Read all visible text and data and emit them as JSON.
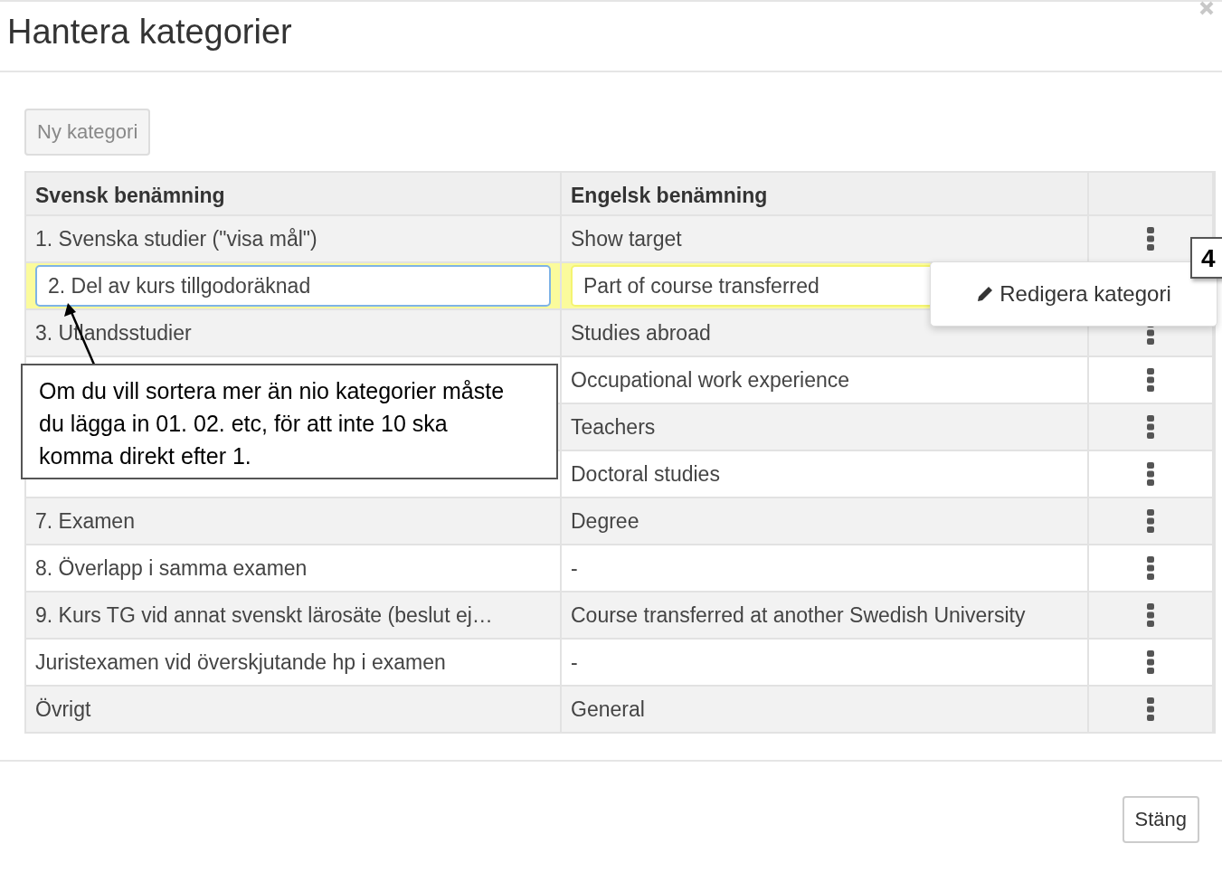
{
  "dialog": {
    "title": "Hantera kategorier",
    "new_button": "Ny kategori",
    "columns": [
      "Svensk benämning",
      "Engelsk benämning"
    ],
    "rows": [
      {
        "sv": "1. Svenska studier (\"visa mål\")",
        "en": "Show target",
        "editing": false
      },
      {
        "sv": "2. Del av kurs tillgodoräknad",
        "en": "Part of course transferred",
        "editing": true
      },
      {
        "sv": "3. Utlandsstudier",
        "en": "Studies abroad",
        "editing": false
      },
      {
        "en": "Occupational work experience",
        "editing": false
      },
      {
        "en": "Teachers",
        "editing": false
      },
      {
        "en": "Doctoral studies",
        "editing": false
      },
      {
        "sv": "7. Examen",
        "en": "Degree",
        "editing": false
      },
      {
        "sv": "8. Överlapp i samma examen",
        "en": "-",
        "editing": false
      },
      {
        "sv": "9. Kurs TG vid annat svenskt lärosäte (beslut ej…",
        "en": "Course transferred at another Swedish University",
        "editing": false
      },
      {
        "sv": "Juristexamen vid överskjutande hp i examen",
        "en": "-",
        "editing": false
      },
      {
        "sv": "Övrigt",
        "en": "General",
        "editing": false
      }
    ],
    "menu": {
      "items": [
        "Redigera kategori"
      ]
    },
    "close_button": "Stäng"
  },
  "annotations": [
    {
      "kind": "callout",
      "text": "Om du vill sortera mer än nio kategorier måste du lägga in 01. 02. etc, för att inte 10 ska komma direkt efter 1."
    },
    {
      "kind": "step",
      "text": "4"
    }
  ]
}
